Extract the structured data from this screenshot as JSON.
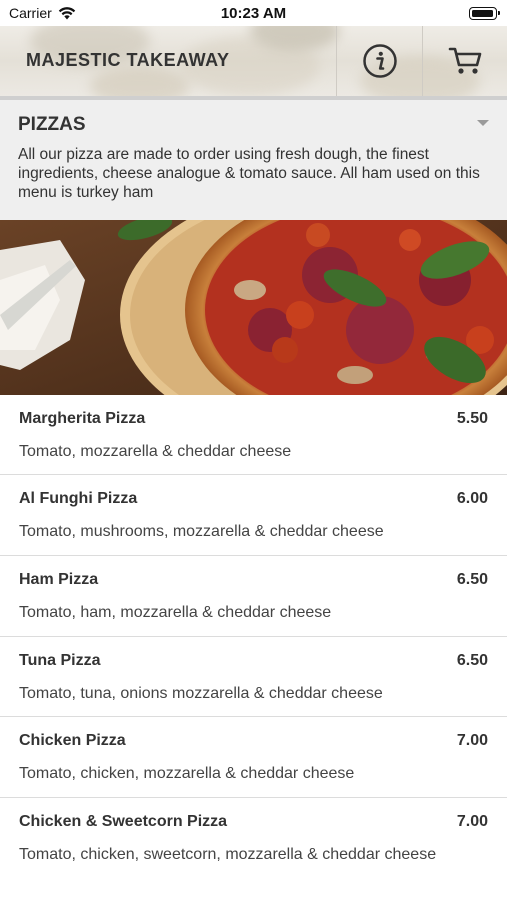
{
  "status_bar": {
    "carrier": "Carrier",
    "time": "10:23 AM",
    "icons": [
      "wifi-icon",
      "battery-icon"
    ]
  },
  "header": {
    "title": "MAJESTIC TAKEAWAY",
    "buttons": [
      "info-icon",
      "cart-icon"
    ]
  },
  "category": {
    "title": "PIZZAS",
    "description": "All our pizza are made to order using fresh dough, the finest ingredients, cheese analogue & tomato sauce. All ham used on this menu is turkey ham",
    "icon": "chevron-down-icon"
  },
  "menu_items": [
    {
      "name": "Margherita Pizza",
      "price": "5.50",
      "description": "Tomato, mozzarella & cheddar cheese"
    },
    {
      "name": "Al Funghi Pizza",
      "price": "6.00",
      "description": "Tomato, mushrooms, mozzarella & cheddar cheese"
    },
    {
      "name": "Ham Pizza",
      "price": "6.50",
      "description": "Tomato, ham, mozzarella & cheddar cheese"
    },
    {
      "name": "Tuna Pizza",
      "price": "6.50",
      "description": "Tomato, tuna, onions mozzarella & cheddar cheese"
    },
    {
      "name": "Chicken Pizza",
      "price": "7.00",
      "description": "Tomato, chicken, mozzarella & cheddar cheese"
    },
    {
      "name": "Chicken & Sweetcorn Pizza",
      "price": "7.00",
      "description": "Tomato, chicken, sweetcorn, mozzarella & cheddar cheese"
    }
  ],
  "colors": {
    "header_bg": "#e8e5de",
    "category_bg": "#efefef",
    "text_dark": "#333333",
    "divider": "#dcdcdc"
  }
}
